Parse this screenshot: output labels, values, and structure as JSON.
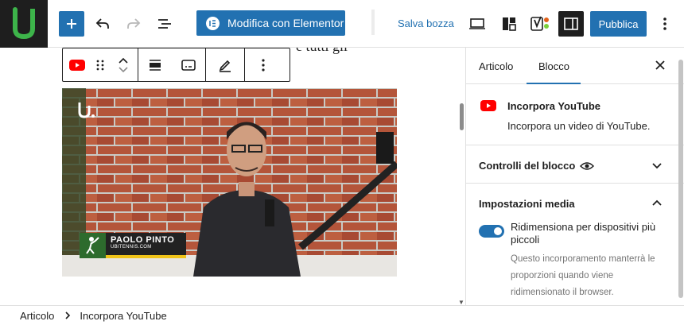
{
  "toolbar": {
    "elementor_label": "Modifica con Elementor",
    "save_draft_label": "Salva bozza",
    "publish_label": "Pubblica",
    "accent": "#2271b1"
  },
  "canvas": {
    "background_text": "e tutti gli"
  },
  "video": {
    "name_label": "PAOLO PINTO",
    "site_label": "UBITENNIS.COM"
  },
  "sidebar": {
    "tabs": [
      {
        "label": "Articolo"
      },
      {
        "label": "Blocco"
      }
    ],
    "block_card": {
      "title": "Incorpora YouTube",
      "description": "Incorpora un video di YouTube."
    },
    "panels": {
      "controls_title": "Controlli del blocco",
      "media_title": "Impostazioni media",
      "toggle_label": "Ridimensiona per dispositivi più piccoli",
      "help_text": "Questo incorporamento manterrà le proporzioni quando viene ridimensionato il browser."
    }
  },
  "breadcrumb": {
    "items": [
      "Articolo",
      "Incorpora YouTube"
    ]
  }
}
